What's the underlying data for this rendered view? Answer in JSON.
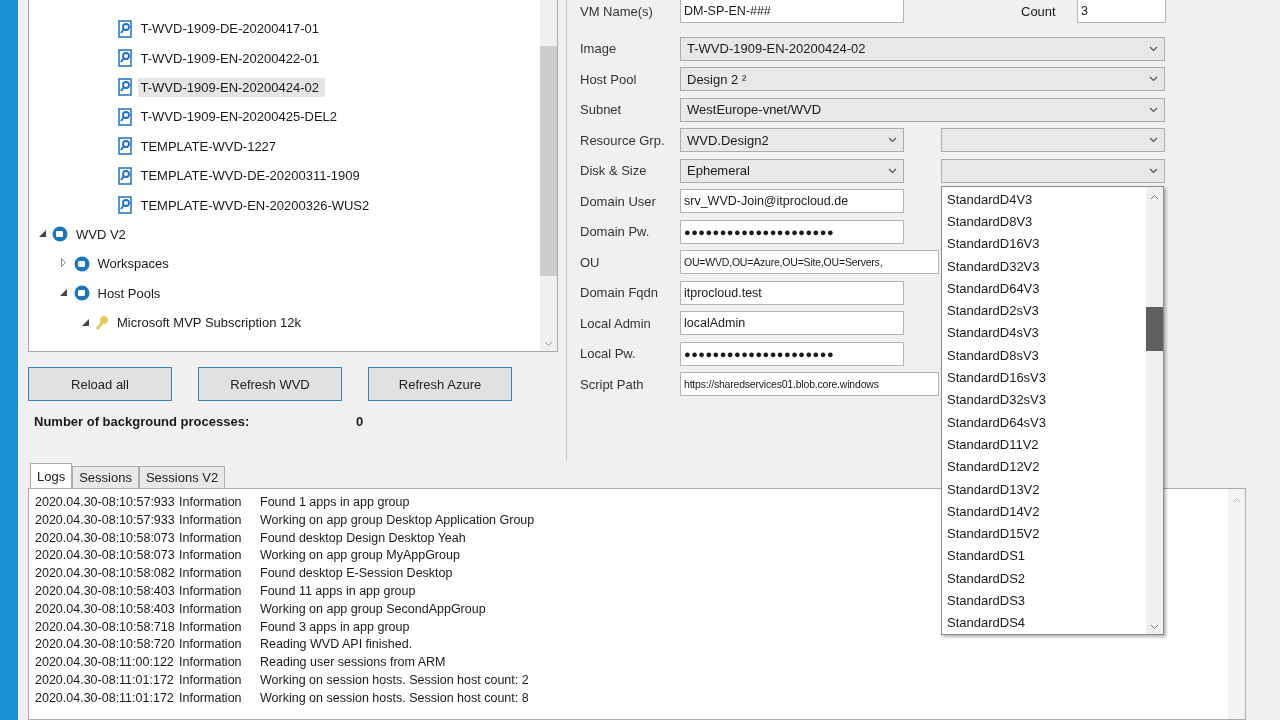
{
  "tree": {
    "image_items": [
      {
        "label": "T-WVD-1909-DE-20200417-01",
        "selected": false
      },
      {
        "label": "T-WVD-1909-EN-20200422-01",
        "selected": false
      },
      {
        "label": "T-WVD-1909-EN-20200424-02",
        "selected": true
      },
      {
        "label": "T-WVD-1909-EN-20200425-DEL2",
        "selected": false
      },
      {
        "label": "TEMPLATE-WVD-1227",
        "selected": false
      },
      {
        "label": "TEMPLATE-WVD-DE-20200311-1909",
        "selected": false
      },
      {
        "label": "TEMPLATE-WVD-EN-20200326-WUS2",
        "selected": false
      }
    ],
    "nodes": [
      {
        "label": "WVD V2",
        "kind": "service",
        "expanded": true,
        "children": [
          {
            "label": "Workspaces",
            "kind": "service",
            "expanded": false
          },
          {
            "label": "Host Pools",
            "kind": "service",
            "expanded": true,
            "children": [
              {
                "label": "Microsoft MVP Subscription 12k",
                "kind": "key",
                "expanded": true
              }
            ]
          }
        ]
      }
    ]
  },
  "buttons": [
    "Reload all",
    "Refresh WVD",
    "Refresh Azure"
  ],
  "background": {
    "label": "Number of background processes:",
    "value": "0"
  },
  "form": {
    "vm_name": {
      "label": "VM Name(s)",
      "value": "DM-SP-EN-###"
    },
    "count": {
      "label": "Count",
      "value": "3"
    },
    "rows": [
      {
        "label": "Image",
        "kind": "combo",
        "value": "T-WVD-1909-EN-20200424-02",
        "wide": true
      },
      {
        "label": "Host Pool",
        "kind": "combo",
        "value": "Design 2 ²",
        "wide": true
      },
      {
        "label": "Subnet",
        "kind": "combo",
        "value": "WestEurope-vnet/WVD",
        "wide": true
      },
      {
        "label": "Resource Grp.",
        "kind": "combo",
        "value": "WVD.Design2",
        "wide": false,
        "second": ""
      },
      {
        "label": "Disk & Size",
        "kind": "combo",
        "value": "Ephemeral",
        "wide": false,
        "second": ""
      },
      {
        "label": "Domain User",
        "kind": "text",
        "value": "srv_WVD-Join@itprocloud.de",
        "wide": false
      },
      {
        "label": "Domain Pw.",
        "kind": "password",
        "value": "●●●●●●●●●●●●●●●●●●●●●",
        "wide": false
      },
      {
        "label": "OU",
        "kind": "text",
        "value": "OU=WVD,OU=Azure,OU=Site,OU=Servers,",
        "wide": true
      },
      {
        "label": "Domain Fqdn",
        "kind": "text",
        "value": "itprocloud.test",
        "wide": false
      },
      {
        "label": "Local Admin",
        "kind": "text",
        "value": "localAdmin",
        "wide": false
      },
      {
        "label": "Local Pw.",
        "kind": "password",
        "value": "●●●●●●●●●●●●●●●●●●●●●",
        "wide": false
      },
      {
        "label": "Script Path",
        "kind": "text",
        "value": "https://sharedservices01.blob.core.windows",
        "wide": true
      }
    ]
  },
  "size_list": [
    "StandardD4V3",
    "StandardD8V3",
    "StandardD16V3",
    "StandardD32V3",
    "StandardD64V3",
    "StandardD2sV3",
    "StandardD4sV3",
    "StandardD8sV3",
    "StandardD16sV3",
    "StandardD32sV3",
    "StandardD64sV3",
    "StandardD11V2",
    "StandardD12V2",
    "StandardD13V2",
    "StandardD14V2",
    "StandardD15V2",
    "StandardDS1",
    "StandardDS2",
    "StandardDS3",
    "StandardDS4"
  ],
  "tabs": [
    {
      "label": "Logs",
      "selected": true
    },
    {
      "label": "Sessions",
      "selected": false
    },
    {
      "label": "Sessions V2",
      "selected": false
    }
  ],
  "log": [
    {
      "time": "2020.04.30-08:10:57:933",
      "level": "Information",
      "message": "Found 1 apps in app group"
    },
    {
      "time": "2020.04.30-08:10:57:933",
      "level": "Information",
      "message": "Working on app group Desktop Application Group"
    },
    {
      "time": "2020.04.30-08:10:58:073",
      "level": "Information",
      "message": "Found desktop Design Desktop Yeah"
    },
    {
      "time": "2020.04.30-08:10:58:073",
      "level": "Information",
      "message": "Working on app group MyAppGroup"
    },
    {
      "time": "2020.04.30-08:10:58:082",
      "level": "Information",
      "message": "Found desktop E-Session Desktop"
    },
    {
      "time": "2020.04.30-08:10:58:403",
      "level": "Information",
      "message": "Found 11 apps in app group"
    },
    {
      "time": "2020.04.30-08:10:58:403",
      "level": "Information",
      "message": "Working on app group SecondAppGroup"
    },
    {
      "time": "2020.04.30-08:10:58:718",
      "level": "Information",
      "message": "Found 3 apps in app group"
    },
    {
      "time": "2020.04.30-08:10:58:720",
      "level": "Information",
      "message": "Reading WVD API finished."
    },
    {
      "time": "2020.04.30-08:11:00:122",
      "level": "Information",
      "message": "Reading user sessions from ARM"
    },
    {
      "time": "2020.04.30-08:11:01:172",
      "level": "Information",
      "message": "Working on session hosts. Session host count: 2"
    },
    {
      "time": "2020.04.30-08:11:01:172",
      "level": "Information",
      "message": "Working on session hosts. Session host count: 8"
    }
  ]
}
